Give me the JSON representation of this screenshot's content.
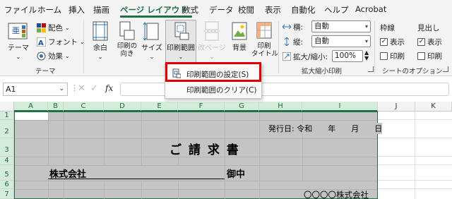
{
  "menu": {
    "tabs": [
      "ファイル",
      "ホーム",
      "挿入",
      "描画",
      "ページ レイアウト",
      "数式",
      "データ",
      "校閲",
      "表示",
      "自動化",
      "ヘルプ",
      "Acrobat"
    ],
    "active_index": 4
  },
  "ribbon": {
    "theme": {
      "theme_btn": "テーマ",
      "colors": "配色",
      "fonts": "フォント",
      "effects": "効果",
      "group_label": "テーマ"
    },
    "page_setup": {
      "margins": "余白",
      "orientation": "印刷の\n向き",
      "size": "サイズ",
      "print_area": "印刷範囲",
      "breaks": "改ページ",
      "background": "背景",
      "print_titles": "印刷\nタイトル"
    },
    "scale": {
      "width_label": "横:",
      "width_value": "自動",
      "height_label": "縦:",
      "height_value": "自動",
      "scale_label": "拡大/縮小:",
      "scale_value": "100%",
      "group_label": "拡大縮小印刷"
    },
    "sheet_options": {
      "gridlines": "枠線",
      "headings": "見出し",
      "view": "表示",
      "print": "印刷",
      "group_label": "シートのオプション"
    }
  },
  "dropdown": {
    "set_print_area": "印刷範囲の設定(S)",
    "clear_print_area": "印刷範囲のクリア(C)"
  },
  "formula_bar": {
    "name_box": "A1",
    "fx": "fx"
  },
  "columns": [
    "A",
    "B",
    "C",
    "D",
    "E",
    "F",
    "G",
    "H",
    "I",
    "J",
    "K"
  ],
  "rows": [
    "1",
    "2",
    "3",
    "4",
    "5",
    "6",
    "7"
  ],
  "sheet": {
    "issue_date": "発行日: 令和　　年　　月　　日",
    "title": "ご 請 求 書",
    "company": "株式会社",
    "onchu": "御中",
    "issuer": "〇〇〇〇株式会社"
  },
  "colors": {
    "accent": "#1e7145",
    "highlight_box": "#e00000",
    "selection": "#c4c4c4"
  }
}
